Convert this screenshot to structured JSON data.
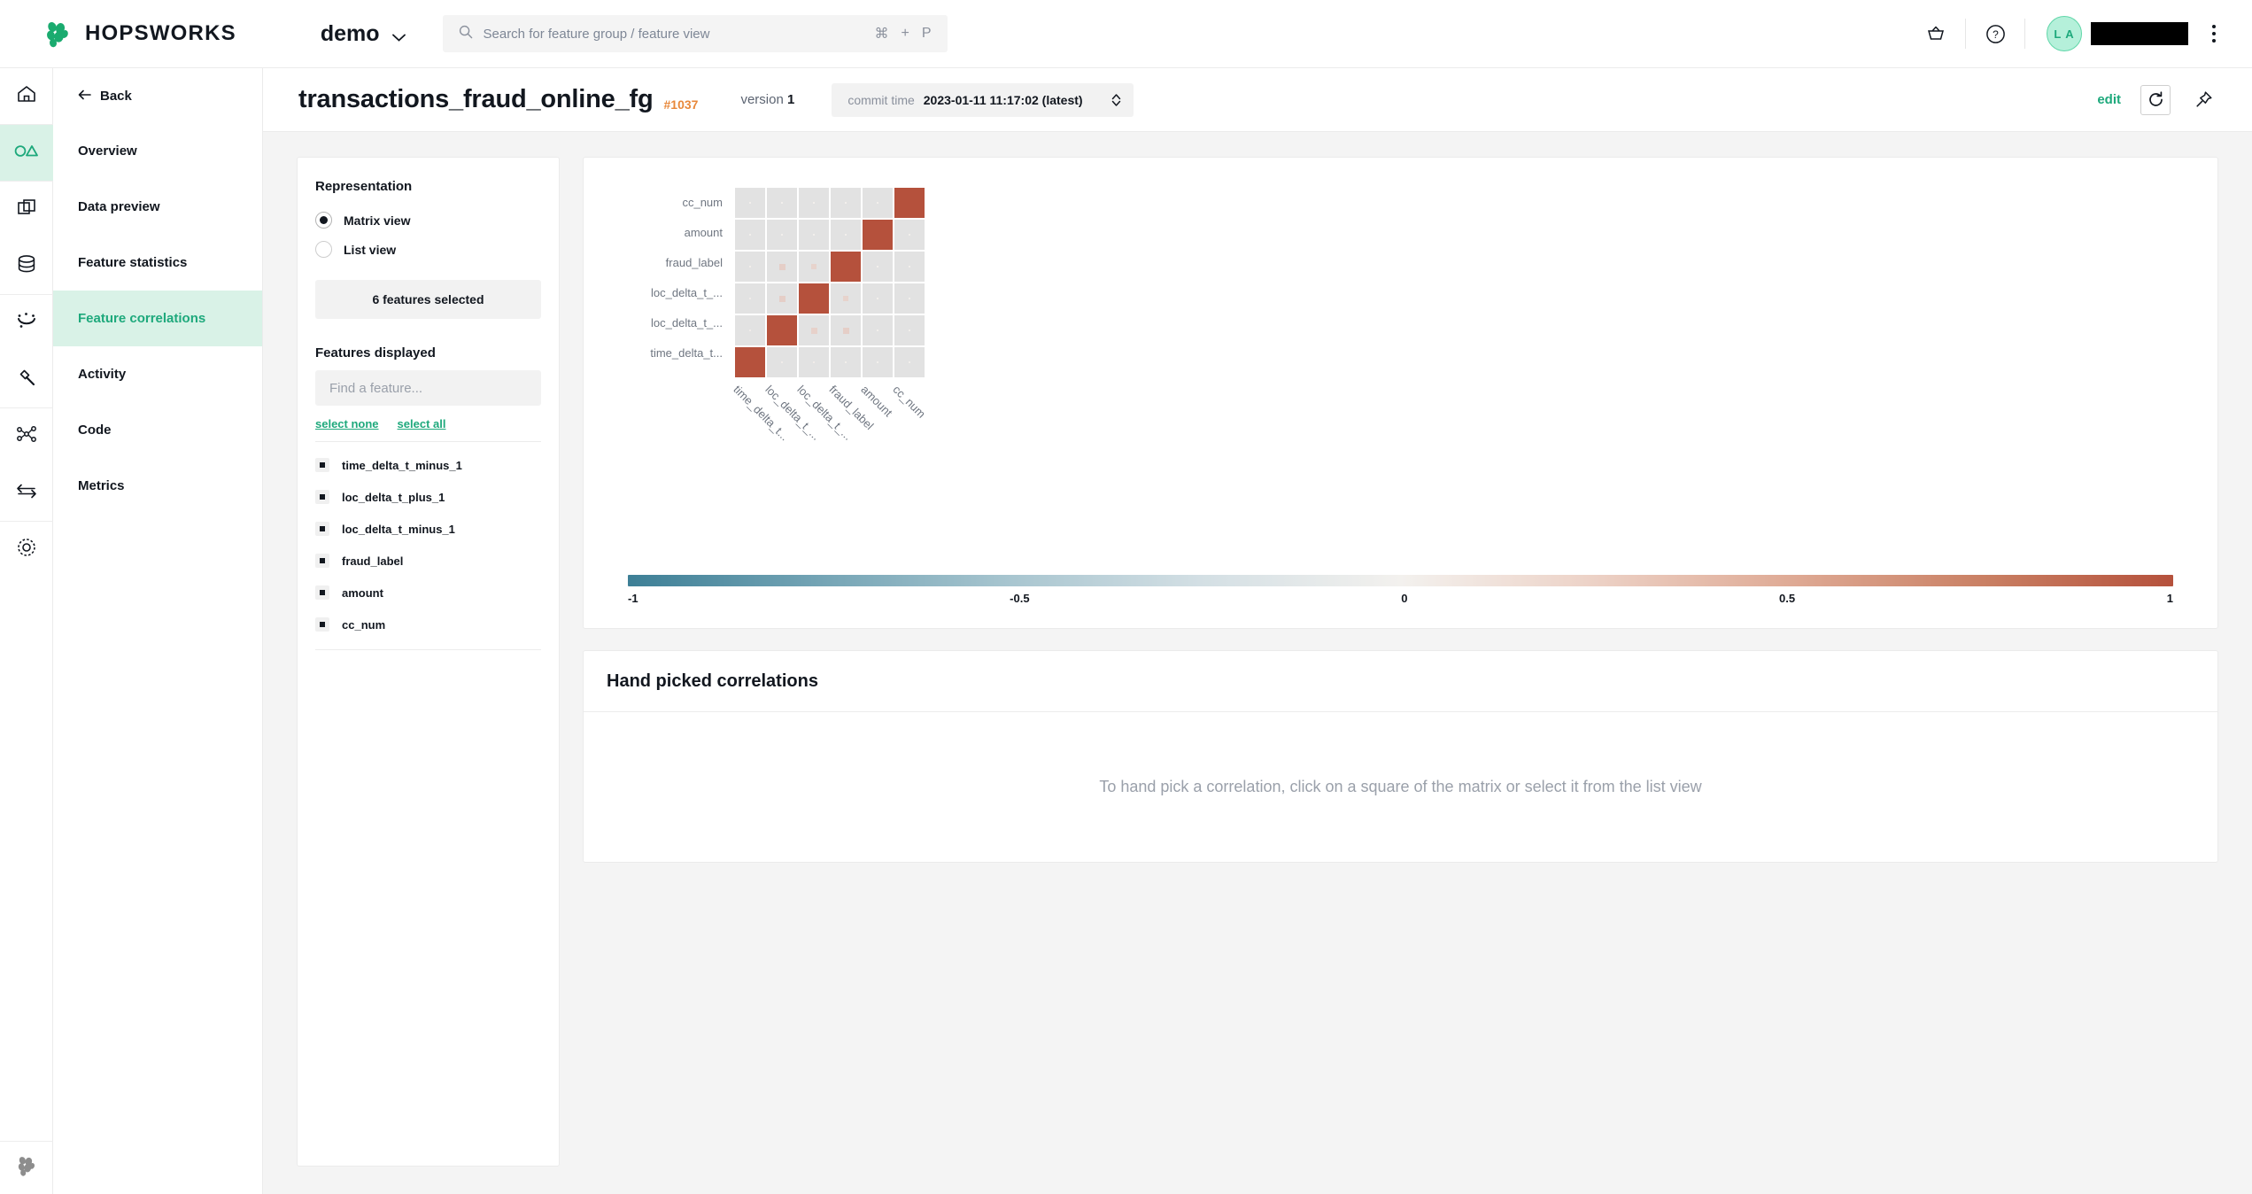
{
  "topbar": {
    "brand": "HOPSWORKS",
    "project": "demo",
    "search_placeholder": "Search for feature group / feature view",
    "kbd": [
      "⌘",
      "+",
      "P"
    ],
    "avatar_initials": "L A"
  },
  "rail": {
    "items": [
      {
        "name": "home-icon",
        "label": "Home"
      },
      {
        "name": "feature-store-icon",
        "label": "Feature Store"
      },
      {
        "name": "feature-views-icon",
        "label": "Feature Views"
      },
      {
        "name": "storage-icon",
        "label": "Storage Connectors"
      },
      {
        "name": "jobs-icon",
        "label": "Jobs"
      },
      {
        "name": "tools-icon",
        "label": "Tools"
      },
      {
        "name": "lineage-icon",
        "label": "Lineage"
      },
      {
        "name": "transfers-icon",
        "label": "Transfers"
      },
      {
        "name": "settings-icon",
        "label": "Settings"
      }
    ],
    "active_index": 1
  },
  "subnav": {
    "back_label": "Back",
    "items": [
      {
        "label": "Overview"
      },
      {
        "label": "Data preview"
      },
      {
        "label": "Feature statistics"
      },
      {
        "label": "Feature correlations"
      },
      {
        "label": "Activity"
      },
      {
        "label": "Code"
      },
      {
        "label": "Metrics"
      }
    ],
    "active_index": 3
  },
  "header": {
    "title": "transactions_fraud_online_fg",
    "id": "#1037",
    "version_label": "version",
    "version_value": "1",
    "commit_label": "commit time",
    "commit_value": "2023-01-11 11:17:02 (latest)",
    "edit_label": "edit"
  },
  "left_panel": {
    "representation_title": "Representation",
    "options": [
      {
        "label": "Matrix view",
        "selected": true
      },
      {
        "label": "List view",
        "selected": false
      }
    ],
    "selected_count": "6 features selected",
    "features_title": "Features displayed",
    "find_placeholder": "Find a feature...",
    "select_none": "select none",
    "select_all": "select all",
    "features": [
      {
        "label": "time_delta_t_minus_1",
        "checked": true
      },
      {
        "label": "loc_delta_t_plus_1",
        "checked": true
      },
      {
        "label": "loc_delta_t_minus_1",
        "checked": true
      },
      {
        "label": "fraud_label",
        "checked": true
      },
      {
        "label": "amount",
        "checked": true
      },
      {
        "label": "cc_num",
        "checked": true
      }
    ]
  },
  "hand_picked": {
    "title": "Hand picked correlations",
    "empty_text": "To hand pick a correlation, click on a square of the matrix or select it from the list view"
  },
  "colors": {
    "accent": "#1ea97c",
    "accent_bg": "#d9f2e7",
    "orange": "#e8883a",
    "positive_max": "#b5513c",
    "negative_max": "#3d7f96",
    "cell_bg": "#e2e2e2"
  },
  "chart_data": {
    "type": "heatmap",
    "title": "",
    "xlabel": "",
    "ylabel": "",
    "legend_position": "bottom",
    "colorbar": {
      "ticks": [
        "-1",
        "-0.5",
        "0",
        "0.5",
        "1"
      ],
      "min": -1,
      "max": 1,
      "low_color": "#3d7f96",
      "mid_color": "#f3f1ee",
      "high_color": "#b5513c"
    },
    "x_categories": [
      "time_delta_t...",
      "loc_delta_t_...",
      "loc_delta_t_...",
      "fraud_label",
      "amount",
      "cc_num"
    ],
    "y_categories": [
      "cc_num",
      "amount",
      "fraud_label",
      "loc_delta_t_...",
      "loc_delta_t_...",
      "time_delta_t..."
    ],
    "x_categories_full": [
      "time_delta_t_minus_1",
      "loc_delta_t_minus_1",
      "loc_delta_t_plus_1",
      "fraud_label",
      "amount",
      "cc_num"
    ],
    "y_categories_full": [
      "cc_num",
      "amount",
      "fraud_label",
      "loc_delta_t_plus_1",
      "loc_delta_t_minus_1",
      "time_delta_t_minus_1"
    ],
    "matrix": [
      [
        0.01,
        0.01,
        0.01,
        0.01,
        0.01,
        1.0
      ],
      [
        0.01,
        0.01,
        0.01,
        0.01,
        1.0,
        0.01
      ],
      [
        0.02,
        0.22,
        0.19,
        1.0,
        0.01,
        0.01
      ],
      [
        0.03,
        0.22,
        1.0,
        0.19,
        0.01,
        0.01
      ],
      [
        0.03,
        1.0,
        0.2,
        0.22,
        0.01,
        0.01
      ],
      [
        1.0,
        0.03,
        0.03,
        0.02,
        0.01,
        0.01
      ]
    ]
  }
}
